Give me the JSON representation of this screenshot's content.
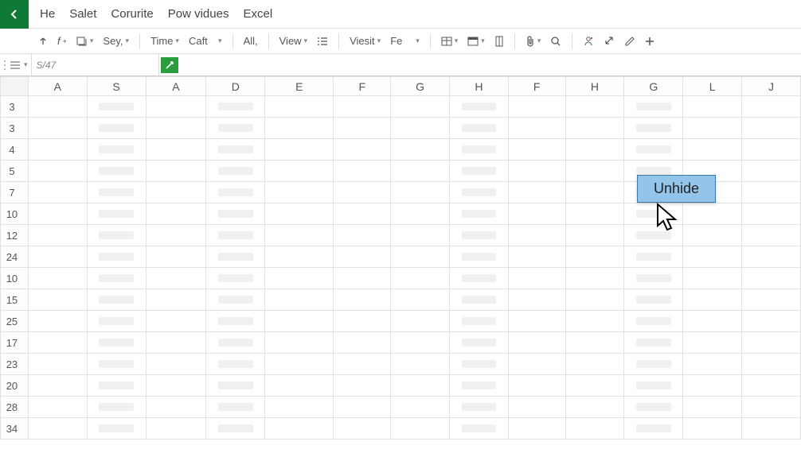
{
  "menubar": {
    "items": [
      "He",
      "Salet",
      "Corurite",
      "Pow vidues",
      "Excel"
    ]
  },
  "toolbar": {
    "sey": "Sey,",
    "time": "Time",
    "caft": "Caft",
    "all": "All,",
    "view": "View",
    "viesit": "Viesit",
    "fe": "Fe"
  },
  "formula_bar": {
    "name_box": "S/47",
    "value": ""
  },
  "grid": {
    "columns": [
      "A",
      "S",
      "A",
      "D",
      "E",
      "F",
      "G",
      "H",
      "F",
      "H",
      "G",
      "L",
      "J"
    ],
    "rows": [
      "3",
      "3",
      "4",
      "5",
      "7",
      "10",
      "12",
      "24",
      "10",
      "15",
      "25",
      "17",
      "23",
      "20",
      "28",
      "34"
    ],
    "placeholder_cols": [
      1,
      3,
      7,
      10
    ]
  },
  "context_menu": {
    "label": "Unhide"
  }
}
